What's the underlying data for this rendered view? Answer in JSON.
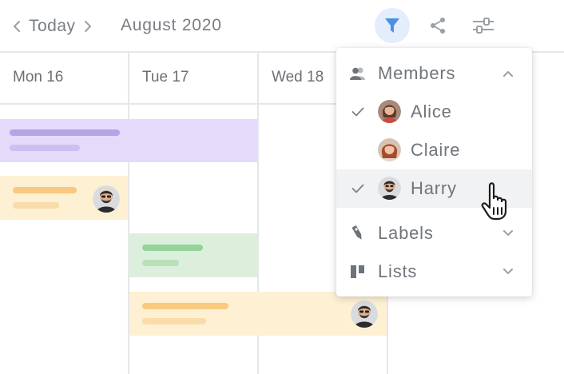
{
  "header": {
    "today_label": "Today",
    "month_label": "August 2020",
    "prev_icon": "chevron-left-icon",
    "next_icon": "chevron-right-icon",
    "tools": [
      "filter-icon",
      "share-icon",
      "sliders-icon"
    ]
  },
  "days": [
    "Mon 16",
    "Tue 17",
    "Wed 18"
  ],
  "events": [
    {
      "color": "purple",
      "avatar": null
    },
    {
      "color": "orange",
      "avatar": "Harry"
    },
    {
      "color": "green",
      "avatar": null
    },
    {
      "color": "orange",
      "avatar": "Harry"
    }
  ],
  "filter_menu": {
    "members": {
      "label": "Members",
      "expanded": true,
      "items": [
        {
          "name": "Alice",
          "checked": true
        },
        {
          "name": "Claire",
          "checked": false
        },
        {
          "name": "Harry",
          "checked": true,
          "hovered": true
        }
      ]
    },
    "labels": {
      "label": "Labels",
      "expanded": false
    },
    "lists": {
      "label": "Lists",
      "expanded": false
    }
  },
  "colors": {
    "accent": "#4a8fe8",
    "filter_bg": "#e4edfb",
    "purple_event": "#e4dbfa",
    "orange_event": "#fdf0d3",
    "green_event": "#dcefdd",
    "grid_line": "#e6e7e9",
    "text": "#6b6f75"
  }
}
